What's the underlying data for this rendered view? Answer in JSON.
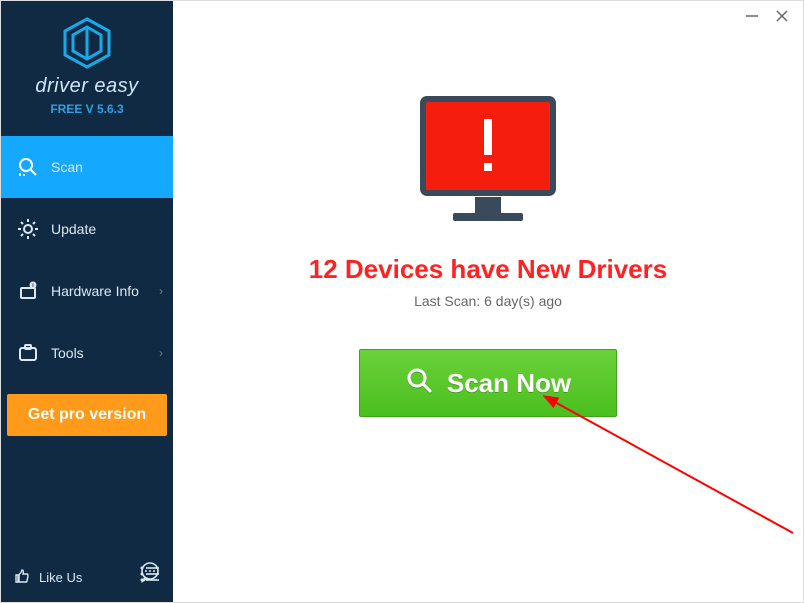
{
  "app": {
    "brand": "driver easy",
    "version": "FREE V 5.6.3"
  },
  "sidebar": {
    "items": [
      {
        "label": "Scan",
        "icon": "search-icon"
      },
      {
        "label": "Update",
        "icon": "gear-icon"
      },
      {
        "label": "Hardware Info",
        "icon": "hardware-icon"
      },
      {
        "label": "Tools",
        "icon": "tools-icon"
      }
    ],
    "pro_label": "Get pro version",
    "likeus_label": "Like Us"
  },
  "main": {
    "headline": "12 Devices have New Drivers",
    "lastscan": "Last Scan: 6 day(s) ago",
    "scan_button": "Scan Now"
  },
  "colors": {
    "sidebar_bg": "#102a43",
    "accent": "#14a8ff",
    "pro_bg": "#ff9a1a",
    "alert_red": "#f22",
    "scan_green": "#4abf1f"
  }
}
